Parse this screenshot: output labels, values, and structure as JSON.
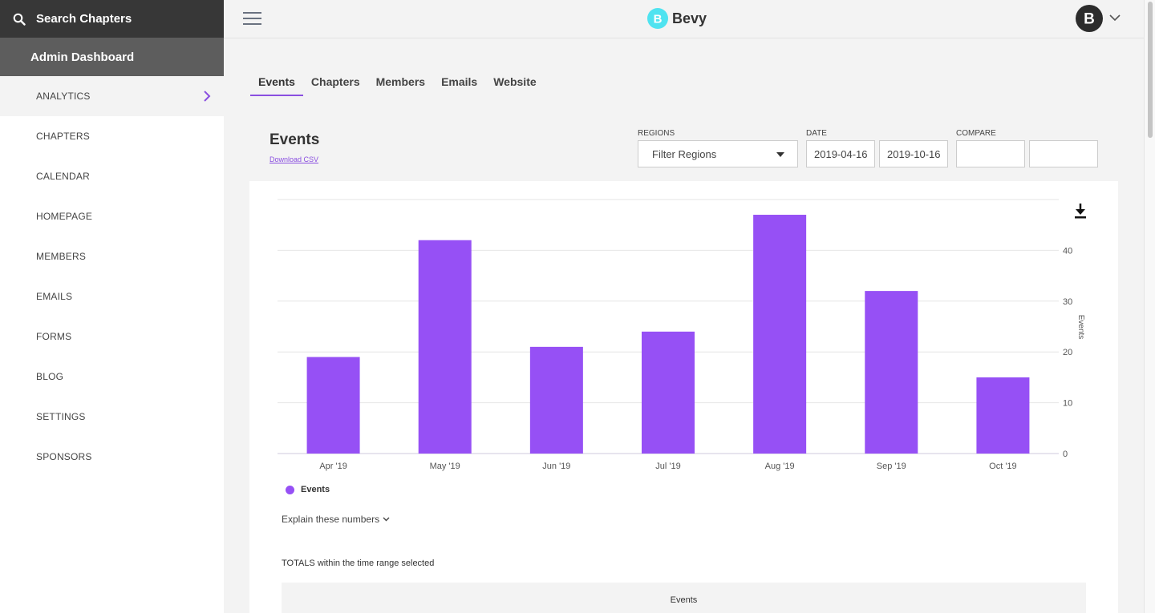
{
  "sidebar": {
    "search_label": "Search Chapters",
    "admin_label": "Admin Dashboard",
    "items": [
      {
        "label": "ANALYTICS"
      },
      {
        "label": "CHAPTERS"
      },
      {
        "label": "CALENDAR"
      },
      {
        "label": "HOMEPAGE"
      },
      {
        "label": "MEMBERS"
      },
      {
        "label": "EMAILS"
      },
      {
        "label": "FORMS"
      },
      {
        "label": "BLOG"
      },
      {
        "label": "SETTINGS"
      },
      {
        "label": "SPONSORS"
      }
    ]
  },
  "header": {
    "logo_text": "Bevy"
  },
  "tabs": [
    {
      "label": "Events"
    },
    {
      "label": "Chapters"
    },
    {
      "label": "Members"
    },
    {
      "label": "Emails"
    },
    {
      "label": "Website"
    }
  ],
  "page": {
    "title": "Events",
    "download_csv": "Download CSV"
  },
  "filters": {
    "regions_label": "REGIONS",
    "regions_value": "Filter Regions",
    "date_label": "DATE",
    "date_start": "2019-04-16",
    "date_end": "2019-10-16",
    "compare_label": "COMPARE",
    "compare_start": "",
    "compare_end": ""
  },
  "chart_data": {
    "type": "bar",
    "categories": [
      "Apr '19",
      "May '19",
      "Jun '19",
      "Jul '19",
      "Aug '19",
      "Sep '19",
      "Oct '19"
    ],
    "series": [
      {
        "name": "Events",
        "values": [
          19,
          42,
          21,
          24,
          47,
          32,
          15
        ]
      }
    ],
    "ylabel": "Events",
    "y_axis_side": "right",
    "yticks": [
      0,
      10,
      20,
      30,
      40
    ],
    "ylim": [
      0,
      50
    ],
    "grid": true,
    "legend": "bottom-left",
    "color": "#9650f5"
  },
  "explain_label": "Explain these numbers",
  "totals": {
    "caption": "TOTALS within the time range selected",
    "column_header": "Events"
  },
  "icons": {
    "search": "search-icon",
    "menu": "hamburger-menu-icon",
    "chevron": "chevron-right-icon",
    "download": "download-icon",
    "avatar_chevron": "chevron-down-icon"
  },
  "colors": {
    "accent": "#8a4fe0",
    "bar": "#9650f5",
    "logo": "#4fe3f0"
  }
}
